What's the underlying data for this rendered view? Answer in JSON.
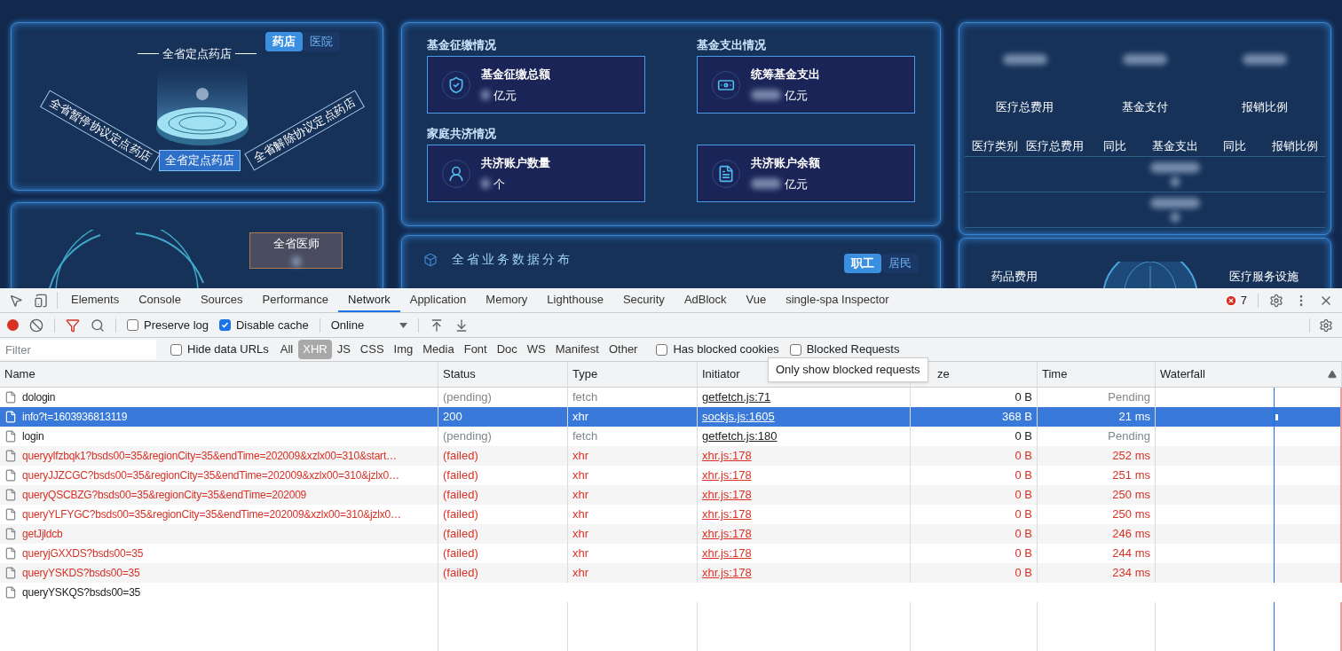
{
  "dashboard": {
    "pharmacy_panel": {
      "tabs": [
        {
          "label": "药店",
          "selected": true
        },
        {
          "label": "医院",
          "selected": false
        }
      ],
      "title": "全省定点药店",
      "center_label": "全省定点药店",
      "left_label": "全省暂停协议定点药店",
      "right_label": "全省解除协议定点药店"
    },
    "doctor_panel": {
      "card_title": "全省医师"
    },
    "fund_panel": {
      "cards": [
        {
          "heading": "基金征缴情况",
          "label": "基金征缴总额",
          "unit": "亿元",
          "kind": "shield"
        },
        {
          "heading": "基金支出情况",
          "label": "统筹基金支出",
          "unit": "亿元",
          "kind": "cash"
        },
        {
          "heading": "家庭共济情况",
          "label": "共济账户数量",
          "unit": "个",
          "kind": "person"
        },
        {
          "label": "共济账户余额",
          "unit": "亿元",
          "kind": "document"
        }
      ]
    },
    "distribution_panel": {
      "title": "全省业务数据分布",
      "tabs": [
        {
          "label": "职工",
          "selected": true
        },
        {
          "label": "居民",
          "selected": false
        }
      ]
    },
    "cost_panel": {
      "summary": [
        "医疗总费用",
        "基金支付",
        "报销比例"
      ],
      "columns": [
        "医疗类别",
        "医疗总费用",
        "同比",
        "基金支出",
        "同比",
        "报销比例"
      ]
    },
    "service_panel": {
      "labels": [
        "药品费用",
        "医疗服务设施"
      ]
    }
  },
  "devtools": {
    "tabs": [
      {
        "label": "Elements",
        "selected": false
      },
      {
        "label": "Console",
        "selected": false
      },
      {
        "label": "Sources",
        "selected": false
      },
      {
        "label": "Performance",
        "selected": false
      },
      {
        "label": "Network",
        "selected": true
      },
      {
        "label": "Application",
        "selected": false
      },
      {
        "label": "Memory",
        "selected": false
      },
      {
        "label": "Lighthouse",
        "selected": false
      },
      {
        "label": "Security",
        "selected": false
      },
      {
        "label": "AdBlock",
        "selected": false
      },
      {
        "label": "Vue",
        "selected": false
      },
      {
        "label": "single-spa Inspector",
        "selected": false
      }
    ],
    "error_count": "7",
    "recording": true,
    "preserve_log": {
      "label": "Preserve log",
      "checked": false
    },
    "disable_cache": {
      "label": "Disable cache",
      "checked": true
    },
    "throttling": "Online",
    "filter_placeholder": "Filter",
    "hide_data_urls": {
      "label": "Hide data URLs",
      "checked": false
    },
    "type_filters": [
      {
        "label": "All",
        "selected": false
      },
      {
        "label": "XHR",
        "selected": true
      },
      {
        "label": "JS",
        "selected": false
      },
      {
        "label": "CSS",
        "selected": false
      },
      {
        "label": "Img",
        "selected": false
      },
      {
        "label": "Media",
        "selected": false
      },
      {
        "label": "Font",
        "selected": false
      },
      {
        "label": "Doc",
        "selected": false
      },
      {
        "label": "WS",
        "selected": false
      },
      {
        "label": "Manifest",
        "selected": false
      },
      {
        "label": "Other",
        "selected": false
      }
    ],
    "has_blocked_cookies": {
      "label": "Has blocked cookies",
      "checked": false
    },
    "blocked_requests": {
      "label": "Blocked Requests",
      "checked": false
    },
    "tooltip": "Only show blocked requests",
    "columns": [
      "Name",
      "Status",
      "Type",
      "Initiator",
      "ze",
      "Time",
      "Waterfall"
    ],
    "rows": [
      {
        "name": "dologin",
        "status": "(pending)",
        "type": "fetch",
        "initiator": "getfetch.js:71",
        "size": "0 B",
        "time": "Pending",
        "kind": "pending",
        "selected": false
      },
      {
        "name": "info?t=1603936813119",
        "status": "200",
        "type": "xhr",
        "initiator": "sockjs.js:1605",
        "size": "368 B",
        "time": "21 ms",
        "kind": "ok",
        "selected": true
      },
      {
        "name": "login",
        "status": "(pending)",
        "type": "fetch",
        "initiator": "getfetch.js:180",
        "size": "0 B",
        "time": "Pending",
        "kind": "pending",
        "selected": false
      },
      {
        "name": "queryylfzbqk1?bsds00=35&regionCity=35&endTime=202009&xzlx00=310&start…",
        "status": "(failed)",
        "type": "xhr",
        "initiator": "xhr.js:178",
        "size": "0 B",
        "time": "252 ms",
        "kind": "failed",
        "selected": false
      },
      {
        "name": "queryJJZCGC?bsds00=35&regionCity=35&endTime=202009&xzlx00=310&jzlx0…",
        "status": "(failed)",
        "type": "xhr",
        "initiator": "xhr.js:178",
        "size": "0 B",
        "time": "251 ms",
        "kind": "failed",
        "selected": false
      },
      {
        "name": "queryQSCBZG?bsds00=35&regionCity=35&endTime=202009",
        "status": "(failed)",
        "type": "xhr",
        "initiator": "xhr.js:178",
        "size": "0 B",
        "time": "250 ms",
        "kind": "failed",
        "selected": false
      },
      {
        "name": "queryYLFYGC?bsds00=35&regionCity=35&endTime=202009&xzlx00=310&jzlx0…",
        "status": "(failed)",
        "type": "xhr",
        "initiator": "xhr.js:178",
        "size": "0 B",
        "time": "250 ms",
        "kind": "failed",
        "selected": false
      },
      {
        "name": "getJjldcb",
        "status": "(failed)",
        "type": "xhr",
        "initiator": "xhr.js:178",
        "size": "0 B",
        "time": "246 ms",
        "kind": "failed",
        "selected": false
      },
      {
        "name": "queryjGXXDS?bsds00=35",
        "status": "(failed)",
        "type": "xhr",
        "initiator": "xhr.js:178",
        "size": "0 B",
        "time": "244 ms",
        "kind": "failed",
        "selected": false
      },
      {
        "name": "queryYSKDS?bsds00=35",
        "status": "(failed)",
        "type": "xhr",
        "initiator": "xhr.js:178",
        "size": "0 B",
        "time": "234 ms",
        "kind": "failed",
        "selected": false
      },
      {
        "name": "queryYSKQS?bsds00=35",
        "kind": "unfinished",
        "selected": false
      }
    ]
  }
}
